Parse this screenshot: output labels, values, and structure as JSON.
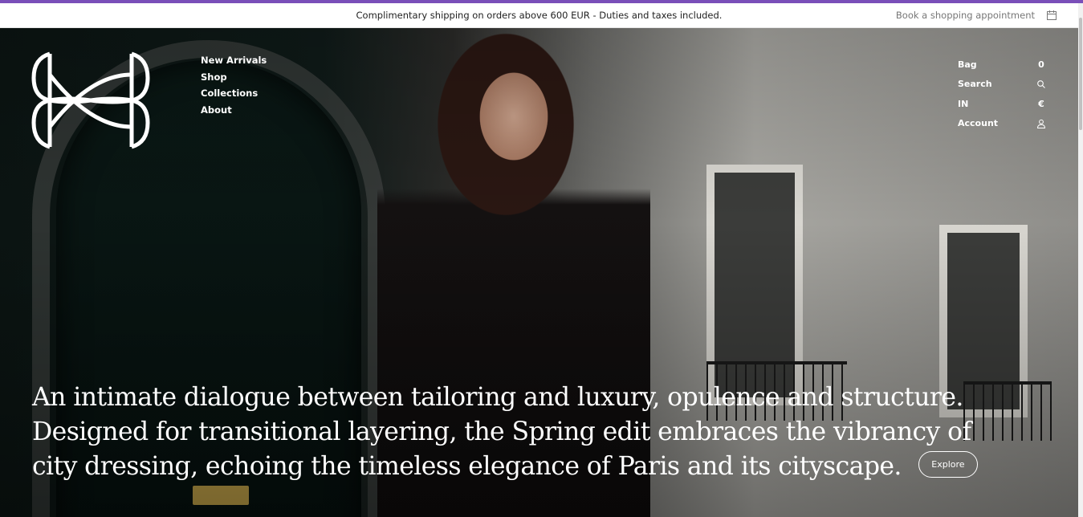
{
  "announcement": {
    "text": "Complimentary shipping on orders above 600 EUR - Duties and taxes included.",
    "appointment_label": "Book a shopping appointment",
    "appointment_icon": "calendar-icon"
  },
  "brand": {
    "logo_icon": "monogram-logo"
  },
  "main_nav": [
    {
      "label": "New Arrivals"
    },
    {
      "label": "Shop"
    },
    {
      "label": "Collections"
    },
    {
      "label": "About"
    }
  ],
  "utility_nav": {
    "bag": {
      "label": "Bag",
      "count": "0"
    },
    "search": {
      "label": "Search",
      "icon": "search-icon"
    },
    "region": {
      "label": "IN",
      "currency": "€"
    },
    "account": {
      "label": "Account",
      "icon": "user-icon"
    }
  },
  "hero": {
    "headline": "An intimate dialogue between tailoring and luxury, opulence and structure. Designed for transitional layering, the Spring edit embraces the vibrancy of city dressing, echoing the timeless elegance of Paris and its cityscape.",
    "cta_label": "Explore"
  },
  "colors": {
    "accent_bar": "#7a4fb9",
    "hero_text": "#ffffff"
  }
}
